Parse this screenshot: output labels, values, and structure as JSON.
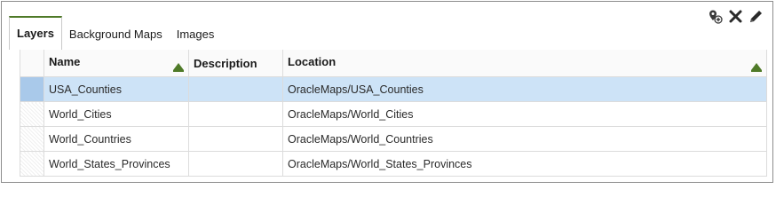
{
  "toolbar": {
    "icons": [
      "add-map-layer-icon",
      "remove-icon",
      "edit-icon"
    ]
  },
  "tabs": [
    {
      "label": "Layers",
      "active": true
    },
    {
      "label": "Background Maps",
      "active": false
    },
    {
      "label": "Images",
      "active": false
    }
  ],
  "table": {
    "columns": [
      "Name",
      "Description",
      "Location"
    ],
    "rows": [
      {
        "name": "USA_Counties",
        "description": "",
        "location": "OracleMaps/USA_Counties",
        "selected": true
      },
      {
        "name": "World_Cities",
        "description": "",
        "location": "OracleMaps/World_Cities",
        "selected": false
      },
      {
        "name": "World_Countries",
        "description": "",
        "location": "OracleMaps/World_Countries",
        "selected": false
      },
      {
        "name": "World_States_Provinces",
        "description": "",
        "location": "OracleMaps/World_States_Provinces",
        "selected": false
      }
    ]
  },
  "colors": {
    "accent": "#4f7a28",
    "selected_row": "#cde3f7"
  }
}
